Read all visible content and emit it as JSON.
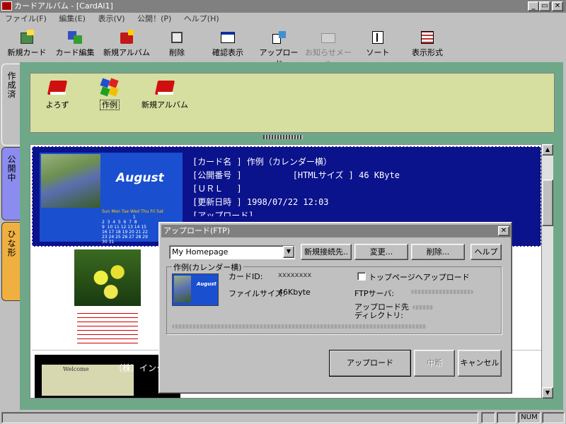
{
  "window": {
    "title": "カードアルバム - [CardAl1]",
    "min": "_",
    "max": "▭",
    "close": "✕"
  },
  "menu": [
    "ファイル(F)",
    "編集(E)",
    "表示(V)",
    "公開！(P)",
    "ヘルプ(H)"
  ],
  "toolbar": [
    {
      "label": "新規カード",
      "icon": "new-card-icon",
      "enabled": true
    },
    {
      "label": "カード編集",
      "icon": "edit-card-icon",
      "enabled": true
    },
    {
      "label": "新規アルバム",
      "icon": "new-album-icon",
      "enabled": true
    },
    {
      "label": "削除",
      "icon": "delete-icon",
      "enabled": true
    },
    {
      "label": "確認表示",
      "icon": "preview-icon",
      "enabled": true
    },
    {
      "label": "アップロード",
      "icon": "upload-icon",
      "enabled": true
    },
    {
      "label": "お知らせメール",
      "icon": "mail-icon",
      "enabled": false
    },
    {
      "label": "ソート",
      "icon": "sort-icon",
      "enabled": true
    },
    {
      "label": "表示形式",
      "icon": "view-format-icon",
      "enabled": true
    }
  ],
  "tabs": [
    {
      "label": "作成済",
      "active": true
    },
    {
      "label": "公開中",
      "active": false
    },
    {
      "label": "ひな形",
      "active": false
    }
  ],
  "albums": [
    {
      "label": "よろず"
    },
    {
      "label": "作例",
      "selected": true
    },
    {
      "label": "新規アルバム"
    }
  ],
  "card1": {
    "month": "August",
    "cal_header": "Sun Mon Tue Wed Thu Fri Sat",
    "cal_rows": [
      "                       1",
      "2  3  4  5  6  7  8",
      "9  10 11 12 13 14 15",
      "16 17 18 19 20 21 22",
      "23 24 25 26 27 28 29",
      "30 31"
    ],
    "name_key": "[カード名 ]",
    "name_val": "作例（カレンダー横）",
    "pubno_key": "[公開番号 ]",
    "html_key": "[HTMLサイズ ]",
    "html_val": "46 KByte",
    "url_key": "[ＵＲＬ　 ]",
    "updated_key": "[更新日時 ]",
    "updated_val": "1998/07/22 12:03",
    "upload_key": "[アップロード]"
  },
  "card3": {
    "text": "（株）インター・グ",
    "thumb_text": "Welcome"
  },
  "dialog": {
    "title": "アップロード(FTP)",
    "site_select": "My Homepage",
    "btn_new_conn": "新規接続先..",
    "btn_change": "変更...",
    "btn_delete": "削除...",
    "btn_help": "ヘルプ",
    "group_label": "作例(カレンダー横)",
    "card_id_label": "カードID:",
    "card_id_val": "xxxxxxxx",
    "filesize_label": "ファイルサイズ:",
    "filesize_val": "46Kbyte",
    "top_upload_label": "トップページへアップロード",
    "ftp_label": "FTPサーバ:",
    "dir_label1": "アップロード先",
    "dir_label2": "ディレクトリ:",
    "thumb_month": "August",
    "btn_upload": "アップロード",
    "btn_abort": "中断",
    "btn_cancel": "キャンセル"
  },
  "status": {
    "num": "NUM"
  },
  "colors": {
    "card_selected_bg": "#0a128c",
    "main_bg": "#6fa889",
    "album_pane_bg": "#d6dea0"
  }
}
